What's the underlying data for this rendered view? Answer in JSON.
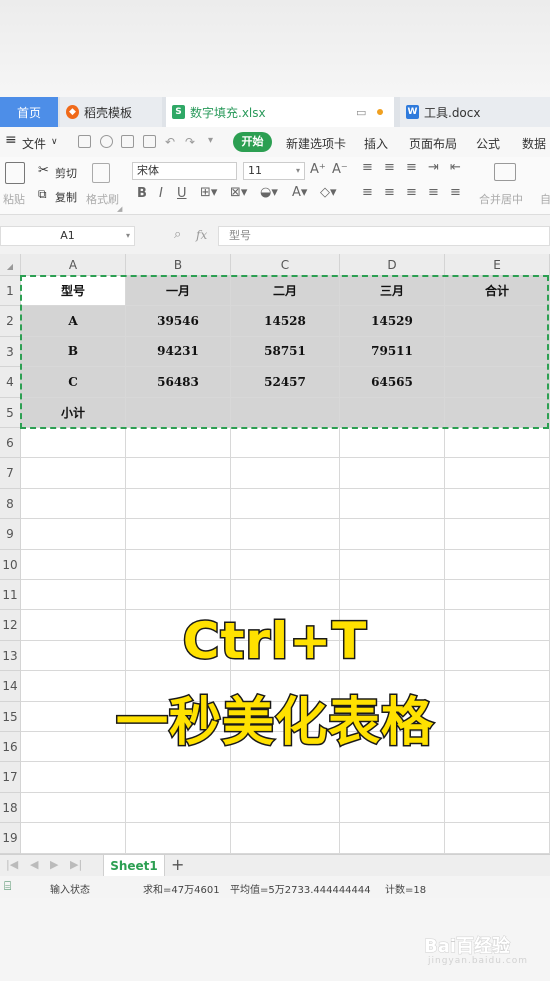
{
  "tabs": [
    {
      "label": "首页"
    },
    {
      "label": "稻壳模板"
    },
    {
      "label": "数字填充.xlsx"
    },
    {
      "label": "工具.docx"
    }
  ],
  "menu": {
    "file": "文件",
    "start": "开始",
    "new_tab": "新建选项卡",
    "insert": "插入",
    "page_layout": "页面布局",
    "formula": "公式",
    "data": "数据"
  },
  "ribbon": {
    "paste": "粘贴",
    "cut": "剪切",
    "copy": "复制",
    "format_painter": "格式刷",
    "font_name": "宋体",
    "font_size": "11",
    "merge_center": "合并居中",
    "auto": "自"
  },
  "formula_bar": {
    "name_box": "A1",
    "fx": "fx",
    "content": "型号"
  },
  "sheet": {
    "columns": [
      "A",
      "B",
      "C",
      "D",
      "E"
    ],
    "rows": [
      "1",
      "2",
      "3",
      "4",
      "5",
      "6",
      "7",
      "8",
      "9",
      "10",
      "11",
      "12",
      "13",
      "14",
      "15",
      "16",
      "17",
      "18",
      "19"
    ],
    "table": [
      [
        "型号",
        "一月",
        "二月",
        "三月",
        "合计"
      ],
      [
        "A",
        "39546",
        "14528",
        "14529",
        ""
      ],
      [
        "B",
        "94231",
        "58751",
        "79511",
        ""
      ],
      [
        "C",
        "56483",
        "52457",
        "64565",
        ""
      ],
      [
        "小计",
        "",
        "",
        "",
        ""
      ]
    ]
  },
  "sheet_tabs": {
    "active": "Sheet1",
    "add": "+"
  },
  "status": {
    "mode": "输入状态",
    "sum": "求和=47万4601",
    "avg": "平均值=5万2733.444444444",
    "count": "计数=18"
  },
  "overlay": {
    "line1": "Ctrl+T",
    "line2": "一秒美化表格"
  },
  "watermark": {
    "brand": "Bai百经验",
    "sub": "jingyan.baidu.com"
  },
  "colors": {
    "accent_green": "#2c9f52",
    "home_tab_blue": "#4d8ee8",
    "overlay_yellow": "#ffe100",
    "selection_gray": "#d4d4d4"
  }
}
